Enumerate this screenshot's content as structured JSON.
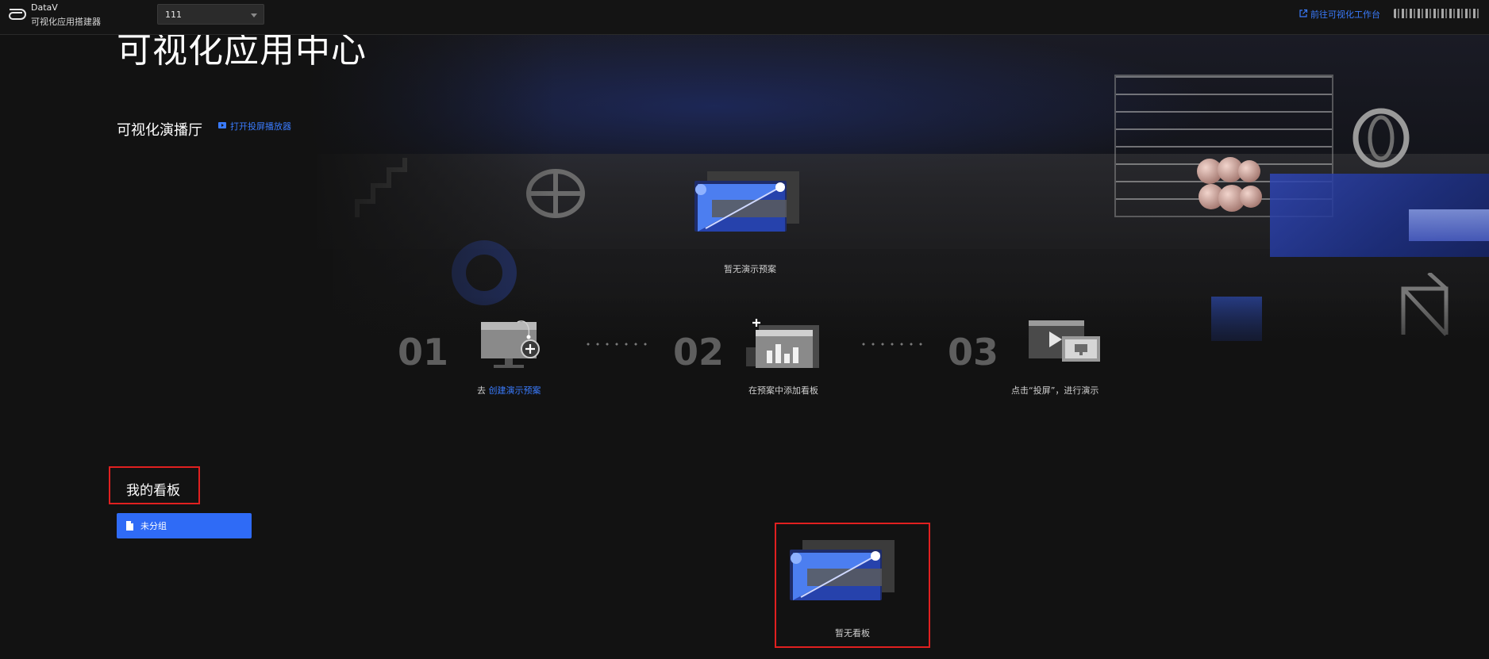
{
  "topbar": {
    "brand_name": "DataV",
    "brand_subtitle": "可视化应用搭建器",
    "workspace_select_value": "111",
    "workspace_link": "前往可视化工作台"
  },
  "hero": {
    "title": "可视化应用中心"
  },
  "hall": {
    "title": "可视化演播厅",
    "open_player_link": "打开投屏播放器",
    "empty_text": "暂无演示预案"
  },
  "steps": [
    {
      "num": "01",
      "prefix": "去 ",
      "link": "创建演示预案",
      "text": ""
    },
    {
      "num": "02",
      "prefix": "",
      "link": "",
      "text": "在预案中添加看板"
    },
    {
      "num": "03",
      "prefix": "",
      "link": "",
      "text": "点击“投屏”，进行演示"
    }
  ],
  "kanban": {
    "title": "我的看板",
    "group_label": "未分组",
    "empty_text": "暂无看板"
  },
  "colors": {
    "accent": "#3a7bfd",
    "button": "#2f6bf6",
    "highlight_border": "#e02020",
    "background": "#121212"
  }
}
